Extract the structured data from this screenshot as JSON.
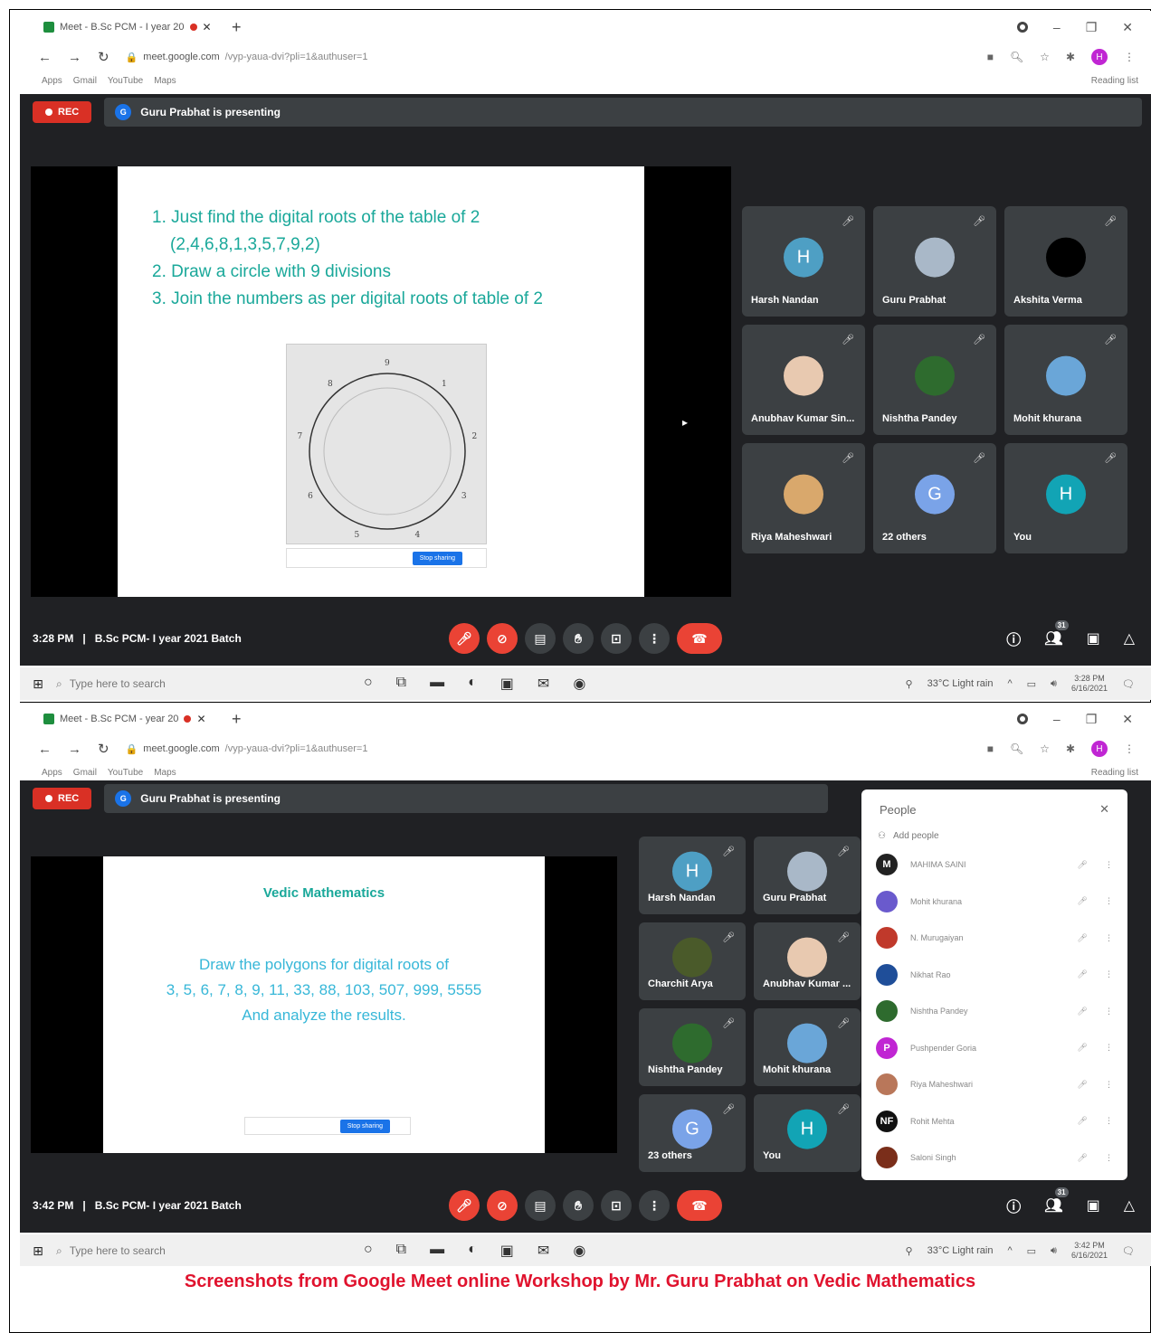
{
  "shot1": {
    "tab_title": "Meet - B.Sc PCM - I year 20",
    "url_host": "meet.google.com",
    "url_rest": "/vyp-yaua-dvi?pli=1&authuser=1",
    "bookmarks": [
      "Apps",
      "Gmail",
      "YouTube",
      "Maps"
    ],
    "reading_list": "Reading list",
    "rec_label": "REC",
    "presenter_initial": "G",
    "presenting": "Guru Prabhat is presenting",
    "slide_lines": [
      "1. Just find the digital roots of the table of 2",
      "(2,4,6,8,1,3,5,7,9,2)",
      "2. Draw a circle with 9 divisions",
      "3. Join the numbers as per digital roots of table of 2"
    ],
    "circle_labels": [
      "9",
      "1",
      "2",
      "3",
      "4",
      "5",
      "6",
      "7",
      "8"
    ],
    "stop_sharing": "Stop sharing",
    "tiles": [
      {
        "name": "Harsh Nandan",
        "initial": "H",
        "color": "#4e9fc4"
      },
      {
        "name": "Guru Prabhat",
        "initial": "",
        "color": "#a9b8c8"
      },
      {
        "name": "Akshita Verma",
        "initial": "",
        "color": "#000000"
      },
      {
        "name": "Anubhav Kumar Sin...",
        "initial": "",
        "color": "#e8c9b0"
      },
      {
        "name": "Nishtha Pandey",
        "initial": "",
        "color": "#2e6b2e"
      },
      {
        "name": "Mohit khurana",
        "initial": "",
        "color": "#6aa6d8"
      },
      {
        "name": "Riya Maheshwari",
        "initial": "",
        "color": "#d9a86c"
      },
      {
        "name": "22 others",
        "initial": "G",
        "color": "#7aa3e8"
      },
      {
        "name": "You",
        "initial": "H",
        "color": "#12a4b5"
      }
    ],
    "time": "3:28 PM",
    "meeting": "B.Sc PCM- I year 2021 Batch",
    "people_count": "31",
    "search_placeholder": "Type here to search",
    "weather": "33°C  Light rain",
    "clock_time": "3:28 PM",
    "clock_date": "6/16/2021"
  },
  "shot2": {
    "tab_title": "Meet - B.Sc PCM - year 20",
    "url_host": "meet.google.com",
    "url_rest": "/vyp-yaua-dvi?pli=1&authuser=1",
    "bookmarks": [
      "Apps",
      "Gmail",
      "YouTube",
      "Maps"
    ],
    "reading_list": "Reading list",
    "rec_label": "REC",
    "presenter_initial": "G",
    "presenting": "Guru Prabhat is presenting",
    "slide_title": "Vedic Mathematics",
    "slide_lines": [
      "Draw the polygons for digital roots of",
      "3, 5, 6, 7, 8, 9, 11, 33, 88, 103, 507, 999, 5555",
      "And analyze the results."
    ],
    "stop_sharing": "Stop sharing",
    "tiles": [
      {
        "name": "Harsh Nandan",
        "initial": "H",
        "color": "#4e9fc4"
      },
      {
        "name": "Guru Prabhat",
        "initial": "",
        "color": "#a9b8c8"
      },
      {
        "name": "Charchit Arya",
        "initial": "",
        "color": "#4a5a2a"
      },
      {
        "name": "Anubhav Kumar ...",
        "initial": "",
        "color": "#e8c9b0"
      },
      {
        "name": "Nishtha Pandey",
        "initial": "",
        "color": "#2e6b2e"
      },
      {
        "name": "Mohit khurana",
        "initial": "",
        "color": "#6aa6d8"
      },
      {
        "name": "23 others",
        "initial": "G",
        "color": "#7aa3e8"
      },
      {
        "name": "You",
        "initial": "H",
        "color": "#12a4b5"
      }
    ],
    "people_title": "People",
    "add_people": "Add people",
    "people": [
      {
        "name": "MAHIMA SAINI",
        "initial": "M",
        "color": "#222222"
      },
      {
        "name": "Mohit khurana",
        "initial": "",
        "color": "#6a5acd"
      },
      {
        "name": "N. Murugaiyan",
        "initial": "",
        "color": "#c0392b"
      },
      {
        "name": "Nikhat Rao",
        "initial": "",
        "color": "#1f4e99"
      },
      {
        "name": "Nishtha Pandey",
        "initial": "",
        "color": "#2e6b2e"
      },
      {
        "name": "Pushpender Goria",
        "initial": "P",
        "color": "#c026d3"
      },
      {
        "name": "Riya Maheshwari",
        "initial": "",
        "color": "#b9775a"
      },
      {
        "name": "Rohit Mehta",
        "initial": "NF",
        "color": "#111111"
      },
      {
        "name": "Saloni Singh",
        "initial": "",
        "color": "#7a2e1a"
      }
    ],
    "time": "3:42 PM",
    "meeting": "B.Sc PCM- I year 2021 Batch",
    "people_count": "31",
    "search_placeholder": "Type here to search",
    "weather": "33°C  Light rain",
    "clock_time": "3:42 PM",
    "clock_date": "6/16/2021"
  },
  "caption": "Screenshots from Google Meet online Workshop by Mr. Guru Prabhat on Vedic Mathematics"
}
